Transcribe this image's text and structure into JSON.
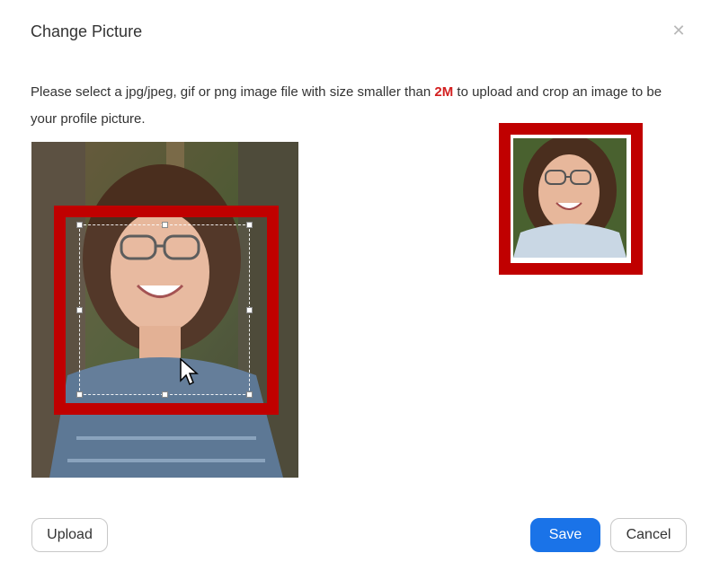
{
  "dialog": {
    "title": "Change Picture",
    "close_icon": "close-icon",
    "description_prefix": "Please select a jpg/jpeg, gif or png image file with size smaller than ",
    "size_limit": "2M",
    "description_suffix": " to upload and crop an image to be your profile picture.",
    "highlight_color": "#d31f1f"
  },
  "editor": {
    "photo_subject": "woman with glasses smiling",
    "annotation_color": "#c00000"
  },
  "buttons": {
    "upload_label": "Upload",
    "save_label": "Save",
    "cancel_label": "Cancel",
    "primary_color": "#1a73e8"
  }
}
